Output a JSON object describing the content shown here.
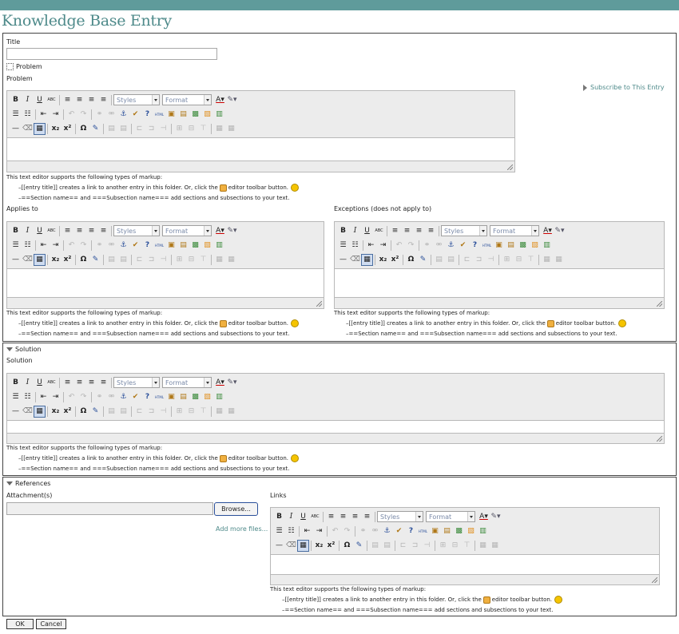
{
  "page_title": "Knowledge Base Entry",
  "title_field": {
    "label": "Title",
    "value": ""
  },
  "problem": {
    "toggle_label": "Problem",
    "label": "Problem"
  },
  "subscribe_label": "Subscribe to This Entry",
  "applies_to": {
    "label": "Applies to"
  },
  "exceptions": {
    "label": "Exceptions (does not apply to)"
  },
  "solution": {
    "toggle_label": "Solution",
    "label": "Solution"
  },
  "references": {
    "toggle_label": "References",
    "attachments_label": "Attachment(s)",
    "browse_label": "Browse...",
    "add_more_label": "Add more files...",
    "links_label": "Links"
  },
  "toolbar": {
    "styles": "Styles",
    "format": "Format"
  },
  "markup_help": {
    "intro": "This text editor supports the following types of markup:",
    "line1_a": "–[[entry title]] creates a link to another entry in this folder. Or, click the",
    "line1_b": "editor toolbar button.",
    "line2": "–==Section name== and ===Subsection name=== add sections and subsections to your text."
  },
  "buttons": {
    "ok": "OK",
    "cancel": "Cancel"
  },
  "colors": {
    "topbar": "#5f9b9b",
    "title": "#4e8a8a"
  }
}
